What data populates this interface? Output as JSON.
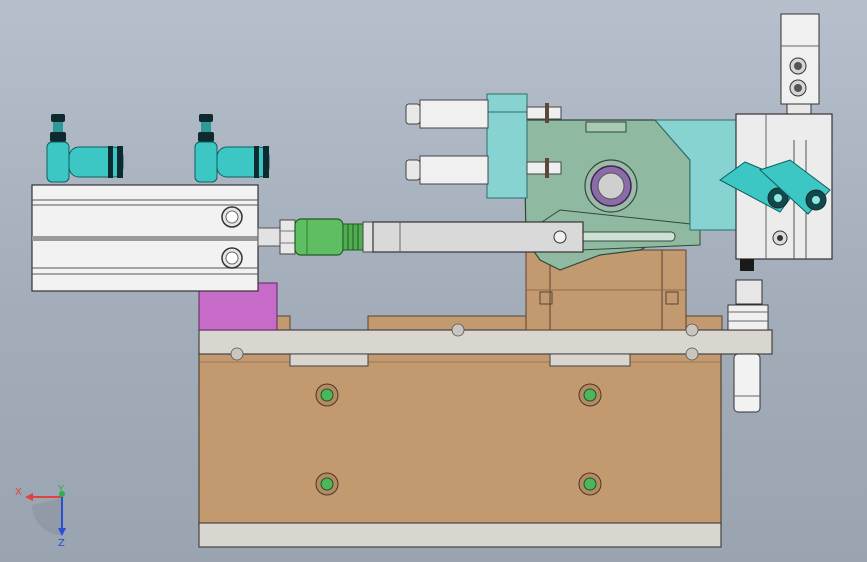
{
  "viewport": {
    "background_top": "#b6bfcb",
    "background_bottom": "#9aa4b1"
  },
  "model_colors": {
    "base_block": "#c39a70",
    "plate": "#d7d5d1",
    "steel": "#d9d9d9",
    "fitting": "#3cc6c4",
    "fitting_dark": "#0f2a2f",
    "coupler": "#5fbe62",
    "clamp_arm": "#8fb9a0",
    "clamp_body": "#86d3d2",
    "purple_block": "#c76bc9",
    "bushing": "#6c4c86",
    "bolt": "#4db65a"
  },
  "triad": {
    "x_label": "X",
    "y_label": "Y",
    "z_label": "Z",
    "x_color": "#e0433b",
    "y_color": "#2bb04a",
    "z_color": "#2a4cd6"
  }
}
